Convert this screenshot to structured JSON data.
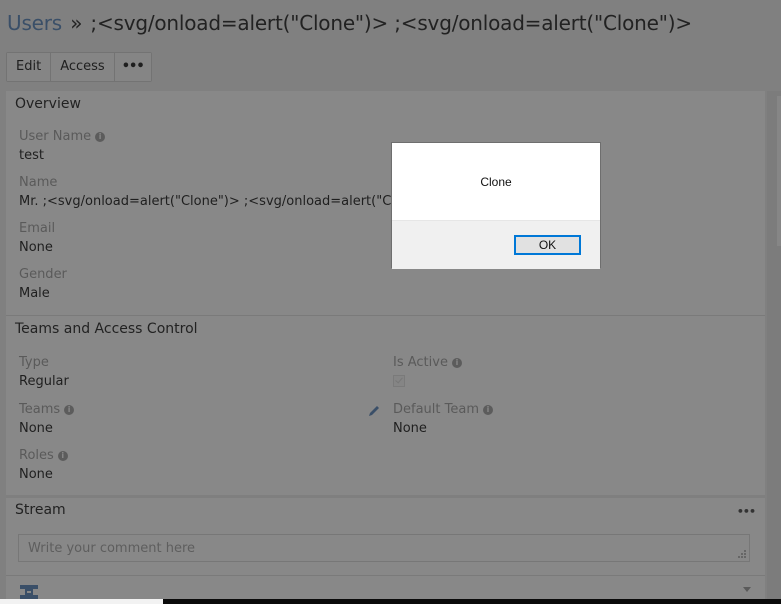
{
  "header": {
    "breadcrumb_root": "Users",
    "separator": "»",
    "record_title": ";<svg/onload=alert(\"Clone\")> ;<svg/onload=alert(\"Clone\")>"
  },
  "toolbar": {
    "edit_label": "Edit",
    "access_label": "Access",
    "more_label": "•••"
  },
  "overview": {
    "title": "Overview",
    "fields": [
      {
        "label": "User Name",
        "value": "test",
        "has_info": true
      },
      {
        "label": "Name",
        "value": "Mr. ;<svg/onload=alert(\"Clone\")> ;<svg/onload=alert(\"Clone\")>",
        "has_info": false
      },
      {
        "label": "Email",
        "value": "None",
        "has_info": false
      },
      {
        "label": "Gender",
        "value": "Male",
        "has_info": false
      }
    ]
  },
  "teams_access": {
    "title": "Teams and Access Control",
    "type": {
      "label": "Type",
      "value": "Regular"
    },
    "is_active": {
      "label": "Is Active",
      "checked": true
    },
    "teams": {
      "label": "Teams",
      "value": "None"
    },
    "default_team": {
      "label": "Default Team",
      "value": "None"
    },
    "roles": {
      "label": "Roles",
      "value": "None"
    }
  },
  "stream": {
    "title": "Stream",
    "more_label": "•••",
    "comment_placeholder": "Write your comment here"
  },
  "alert_dialog": {
    "message": "Clone",
    "ok_label": "OK"
  },
  "colors": {
    "overlay_bg": "#808080",
    "link": "#3a4f68",
    "dialog_focus": "#0078d7"
  }
}
